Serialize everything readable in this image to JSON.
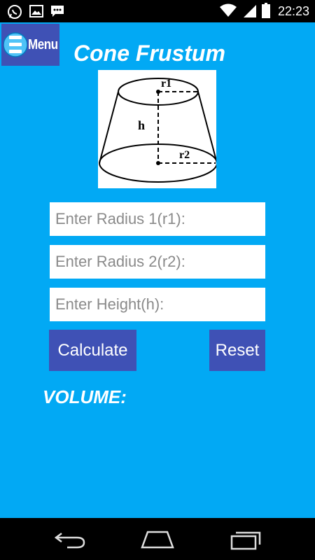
{
  "status_bar": {
    "time": "22:23",
    "icons": [
      "whatsapp-icon",
      "image-icon",
      "message-icon",
      "wifi-icon",
      "signal-icon",
      "battery-icon"
    ]
  },
  "menu": {
    "label": "Menu",
    "icon": "hamburger-icon"
  },
  "page": {
    "title": "Cone Frustum"
  },
  "diagram": {
    "label_r1": "r1",
    "label_h": "h",
    "label_r2": "r2"
  },
  "form": {
    "radius1_placeholder": "Enter Radius 1(r1):",
    "radius2_placeholder": "Enter Radius 2(r2):",
    "height_placeholder": "Enter Height(h):",
    "radius1_value": "",
    "radius2_value": "",
    "height_value": ""
  },
  "buttons": {
    "calculate": "Calculate",
    "reset": "Reset"
  },
  "result": {
    "label": "VOLUME:"
  },
  "nav_bar": {
    "icons": [
      "back-icon",
      "home-icon",
      "recents-icon"
    ]
  },
  "colors": {
    "background": "#02a9f4",
    "button": "#3f51b5",
    "bars": "#000000"
  }
}
